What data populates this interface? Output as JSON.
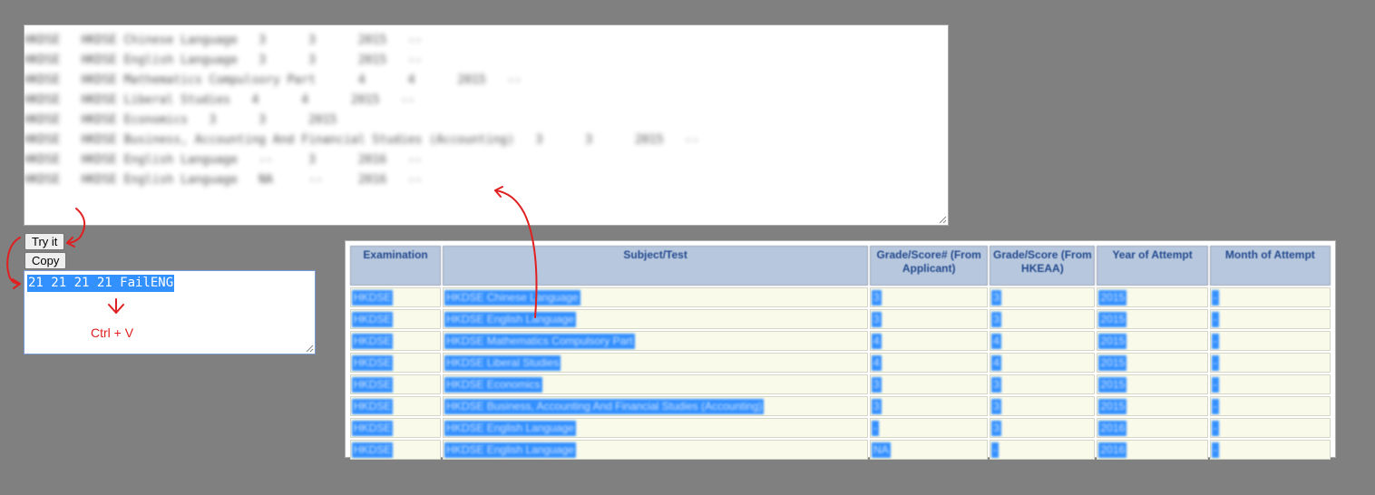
{
  "top_textarea": {
    "lines": [
      "HKDSE   HKDSE Chinese Language   3      3      2015   --",
      "HKDSE   HKDSE English Language   3      3      2015   --",
      "HKDSE   HKDSE Mathematics Compulsory Part      4      4      2015   --",
      "HKDSE   HKDSE Liberal Studies   4      4      2015   --",
      "HKDSE   HKDSE Economics   3      3      2015",
      "HKDSE   HKDSE Business, Accounting And Financial Studies (Accounting)   3      3      2015   --",
      "HKDSE   HKDSE English Language   --     3      2016   --",
      "HKDSE   HKDSE English Language   NA     --     2016   --"
    ]
  },
  "buttons": {
    "try_it": "Try it",
    "copy": "Copy"
  },
  "output": {
    "selected_text": "21 21 21 21 FailENG"
  },
  "annotation": {
    "paste_hint": "Ctrl + V",
    "color": "#e02020"
  },
  "table": {
    "headers": [
      "Examination",
      "Subject/Test",
      "Grade/Score# (From Applicant)",
      "Grade/Score (From HKEAA)",
      "Year of Attempt",
      "Month of Attempt"
    ],
    "rows": [
      [
        "HKDSE",
        "HKDSE Chinese Language",
        "3",
        "3",
        "2015",
        "-"
      ],
      [
        "HKDSE",
        "HKDSE English Language",
        "3",
        "3",
        "2015",
        "-"
      ],
      [
        "HKDSE",
        "HKDSE Mathematics Compulsory Part",
        "4",
        "4",
        "2015",
        "-"
      ],
      [
        "HKDSE",
        "HKDSE Liberal Studies",
        "4",
        "4",
        "2015",
        "-"
      ],
      [
        "HKDSE",
        "HKDSE Economics",
        "3",
        "3",
        "2015",
        "-"
      ],
      [
        "HKDSE",
        "HKDSE Business, Accounting And Financial Studies (Accounting)",
        "3",
        "3",
        "2015",
        "-"
      ],
      [
        "HKDSE",
        "HKDSE English Language",
        "-",
        "3",
        "2016",
        "-"
      ],
      [
        "HKDSE",
        "HKDSE English Language",
        "NA",
        "-",
        "2016",
        "-"
      ]
    ],
    "header_bg": "#b7c7dd",
    "cell_bg": "#fafaea",
    "highlight": "#3390ff"
  }
}
